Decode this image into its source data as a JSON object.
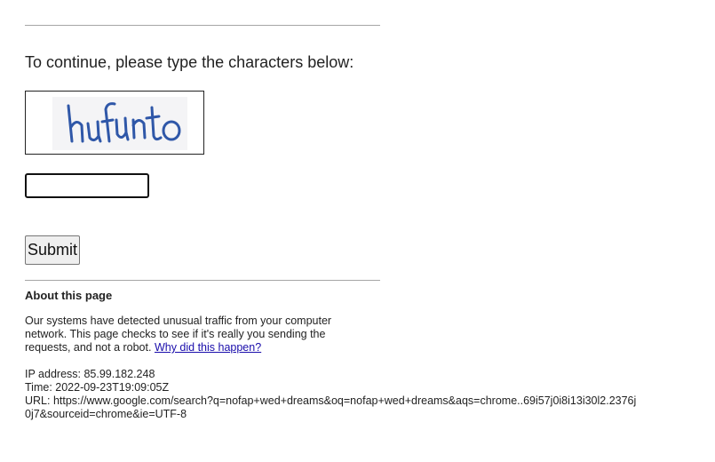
{
  "prompt": "To continue, please type the characters below:",
  "captcha": {
    "text": "hufunto",
    "text_color": "#2f57a8"
  },
  "input": {
    "value": "",
    "placeholder": ""
  },
  "submit_label": "Submit",
  "about": {
    "heading": "About this page",
    "text": "Our systems have detected unusual traffic from your computer network. This page checks to see if it's really you sending the requests, and not a robot.",
    "link": "Why did this happen?",
    "link_color": "#1a0dab"
  },
  "details": {
    "ip": "IP address: 85.99.182.248",
    "time": "Time: 2022-09-23T19:09:05Z",
    "url": "URL: https://www.google.com/search?q=nofap+wed+dreams&oq=nofap+wed+dreams&aqs=chrome..69i57j0i8i13i30l2.2376j0j7&sourceid=chrome&ie=UTF-8"
  }
}
